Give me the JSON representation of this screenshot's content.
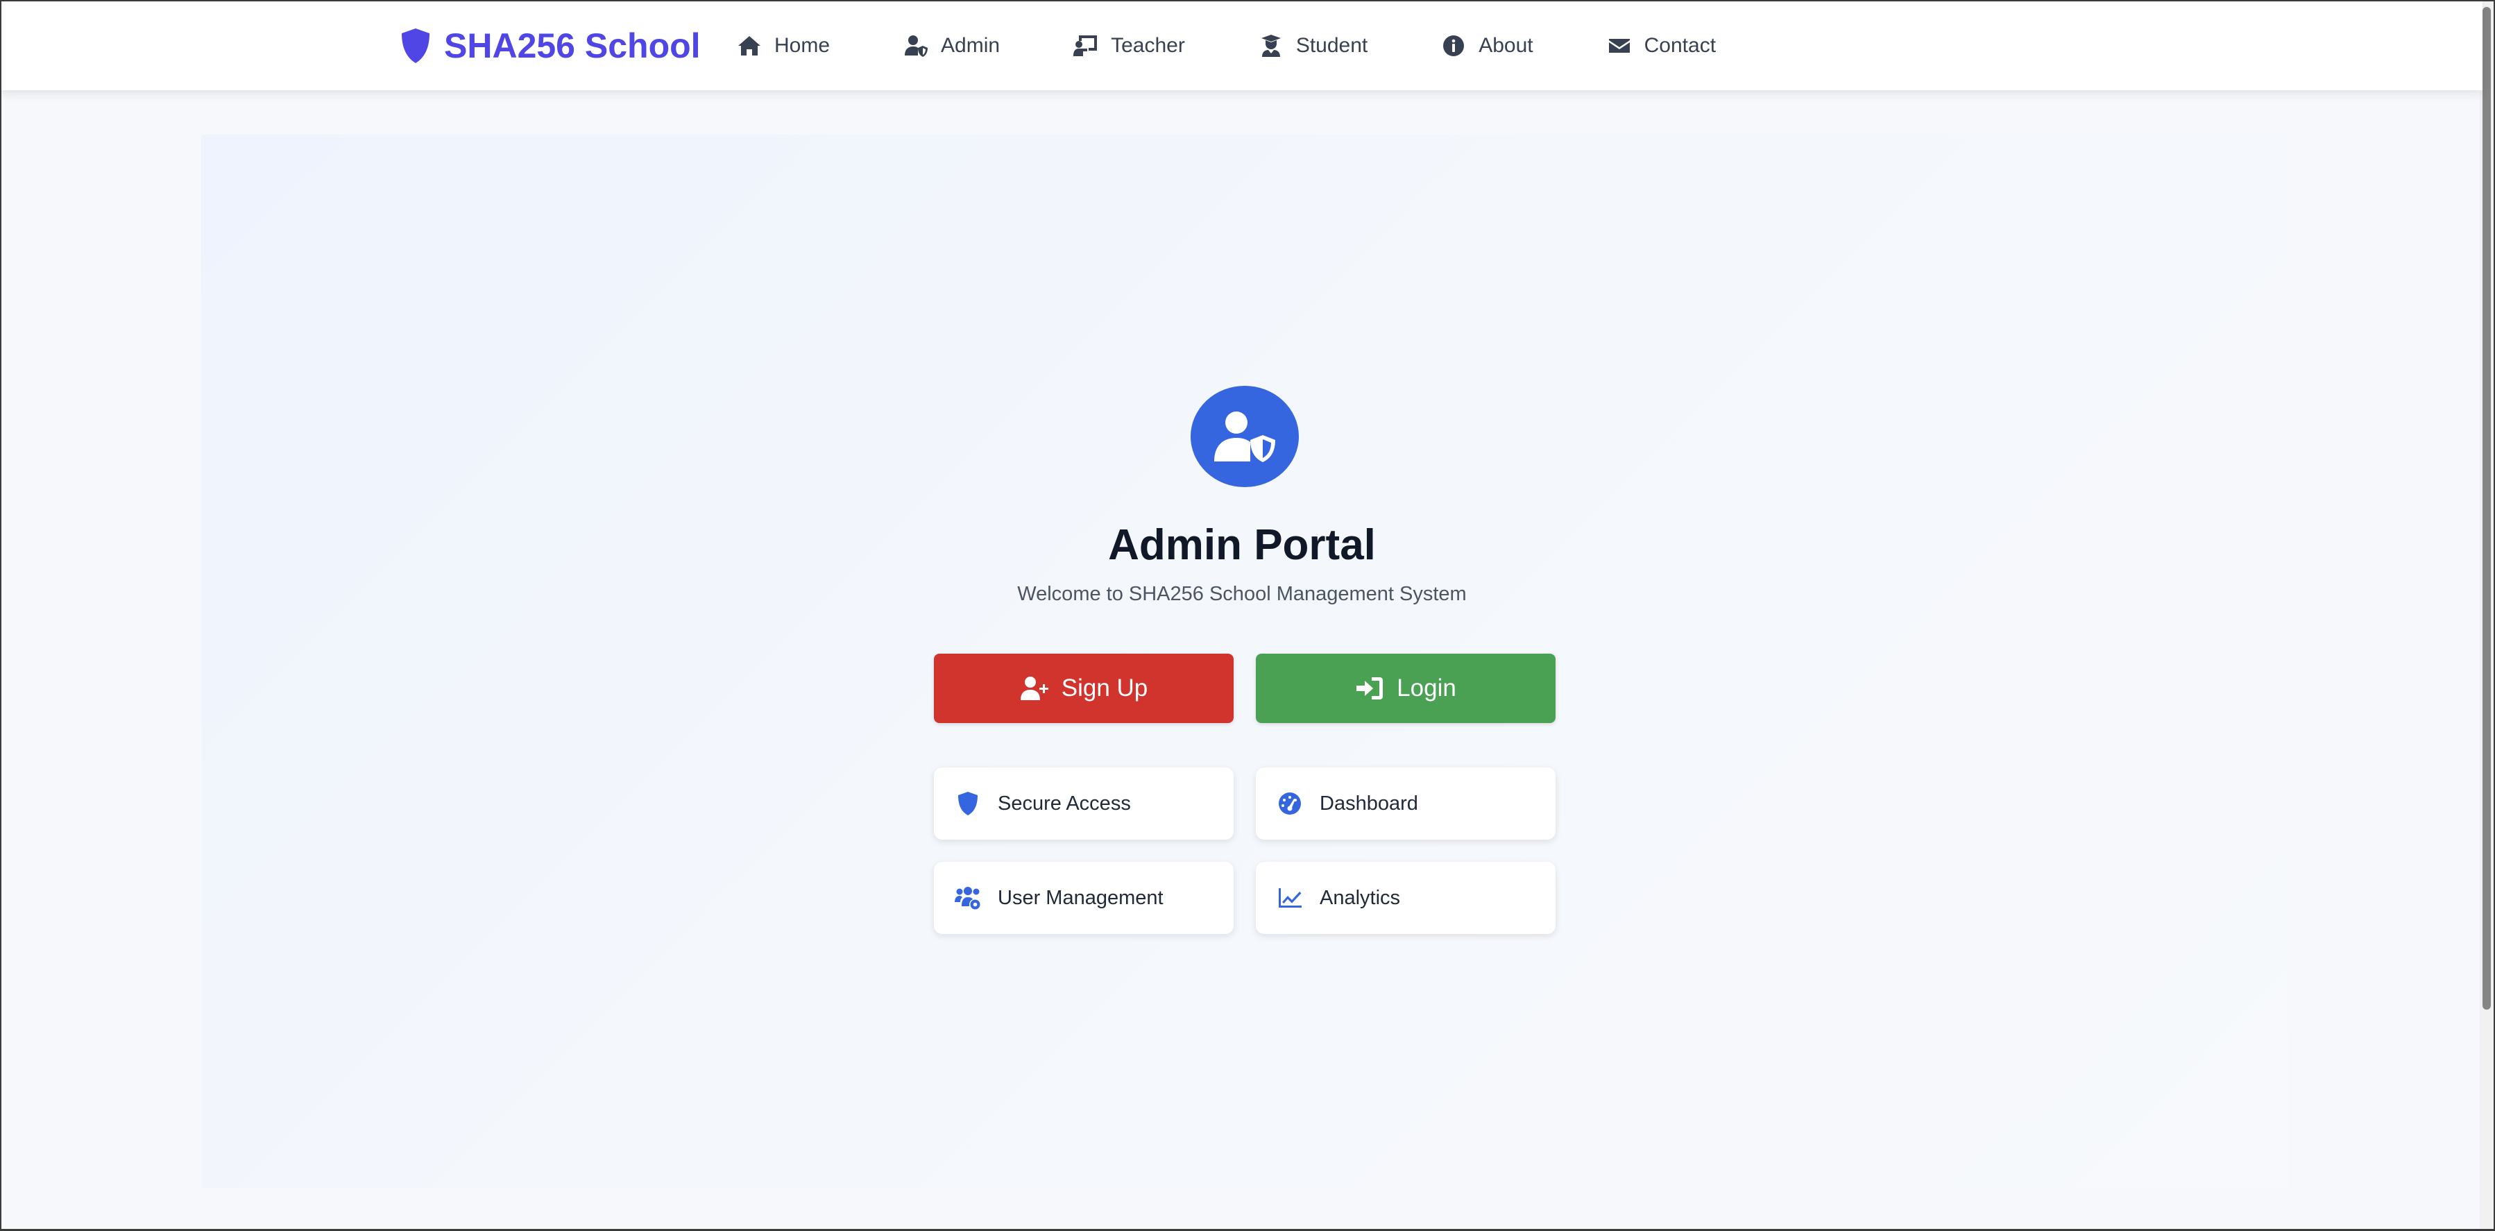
{
  "nav": {
    "brand": "SHA256 School",
    "items": [
      {
        "label": "Home",
        "icon": "home-icon"
      },
      {
        "label": "Admin",
        "icon": "user-shield-icon"
      },
      {
        "label": "Teacher",
        "icon": "chalkboard-teacher-icon"
      },
      {
        "label": "Student",
        "icon": "user-graduate-icon"
      },
      {
        "label": "About",
        "icon": "info-circle-icon"
      },
      {
        "label": "Contact",
        "icon": "envelope-icon"
      }
    ]
  },
  "hero": {
    "icon": "user-shield-icon",
    "title": "Admin Portal",
    "subtitle": "Welcome to SHA256 School Management System"
  },
  "buttons": {
    "signup": {
      "label": "Sign Up",
      "icon": "user-plus-icon",
      "color": "#d0342c"
    },
    "login": {
      "label": "Login",
      "icon": "sign-in-icon",
      "color": "#4aa153"
    }
  },
  "features": [
    {
      "label": "Secure Access",
      "icon": "shield-icon"
    },
    {
      "label": "Dashboard",
      "icon": "dashboard-gauge-icon"
    },
    {
      "label": "User Management",
      "icon": "users-cog-icon"
    },
    {
      "label": "Analytics",
      "icon": "chart-line-icon"
    }
  ],
  "colors": {
    "brand": "#4f46e5",
    "accent": "#3566e0",
    "background": "#f7f8fb"
  }
}
